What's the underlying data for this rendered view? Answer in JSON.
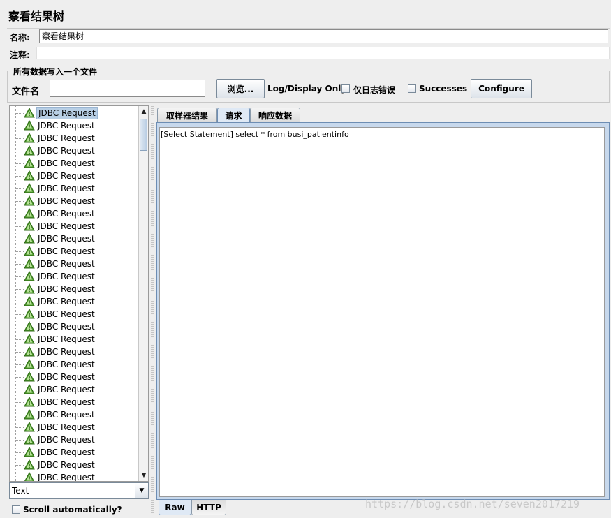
{
  "window": {
    "title": "察看结果树"
  },
  "form": {
    "name_label": "名称:",
    "name_value": "察看结果树",
    "comment_label": "注释:",
    "comment_value": ""
  },
  "file_group": {
    "title": "所有数据写入一个文件",
    "filename_label": "文件名",
    "filename_value": "",
    "browse_label": "浏览...",
    "log_display_label": "Log/Display Only:",
    "errors_label": "仅日志错误",
    "errors_checked": false,
    "successes_label": "Successes",
    "successes_checked": false,
    "configure_label": "Configure"
  },
  "tree": {
    "items": [
      "JDBC Request",
      "JDBC Request",
      "JDBC Request",
      "JDBC Request",
      "JDBC Request",
      "JDBC Request",
      "JDBC Request",
      "JDBC Request",
      "JDBC Request",
      "JDBC Request",
      "JDBC Request",
      "JDBC Request",
      "JDBC Request",
      "JDBC Request",
      "JDBC Request",
      "JDBC Request",
      "JDBC Request",
      "JDBC Request",
      "JDBC Request",
      "JDBC Request",
      "JDBC Request",
      "JDBC Request",
      "JDBC Request",
      "JDBC Request",
      "JDBC Request",
      "JDBC Request",
      "JDBC Request",
      "JDBC Request",
      "JDBC Request",
      "JDBC Request"
    ],
    "selected_index": 0,
    "icon": "warning-triangle-icon",
    "scroll_up_icon": "arrow-up-icon",
    "scroll_down_icon": "arrow-down-icon"
  },
  "renderer": {
    "value": "Text",
    "dropdown_icon": "chevron-down-icon"
  },
  "scroll_auto": {
    "label": "Scroll automatically?",
    "checked": false
  },
  "tabs": [
    {
      "label": "取样器结果",
      "active": false
    },
    {
      "label": "请求",
      "active": true
    },
    {
      "label": "响应数据",
      "active": false
    }
  ],
  "request": {
    "body": "[Select Statement] select * from busi_patientinfo"
  },
  "bottom_tabs": [
    {
      "label": "Raw",
      "active": true
    },
    {
      "label": "HTTP",
      "active": false
    }
  ],
  "watermark": "https://blog.csdn.net/seven2017219",
  "colors": {
    "accent": "#6d8db3",
    "selection": "#b8cfe5",
    "icon_green": "#4c9a2a"
  }
}
